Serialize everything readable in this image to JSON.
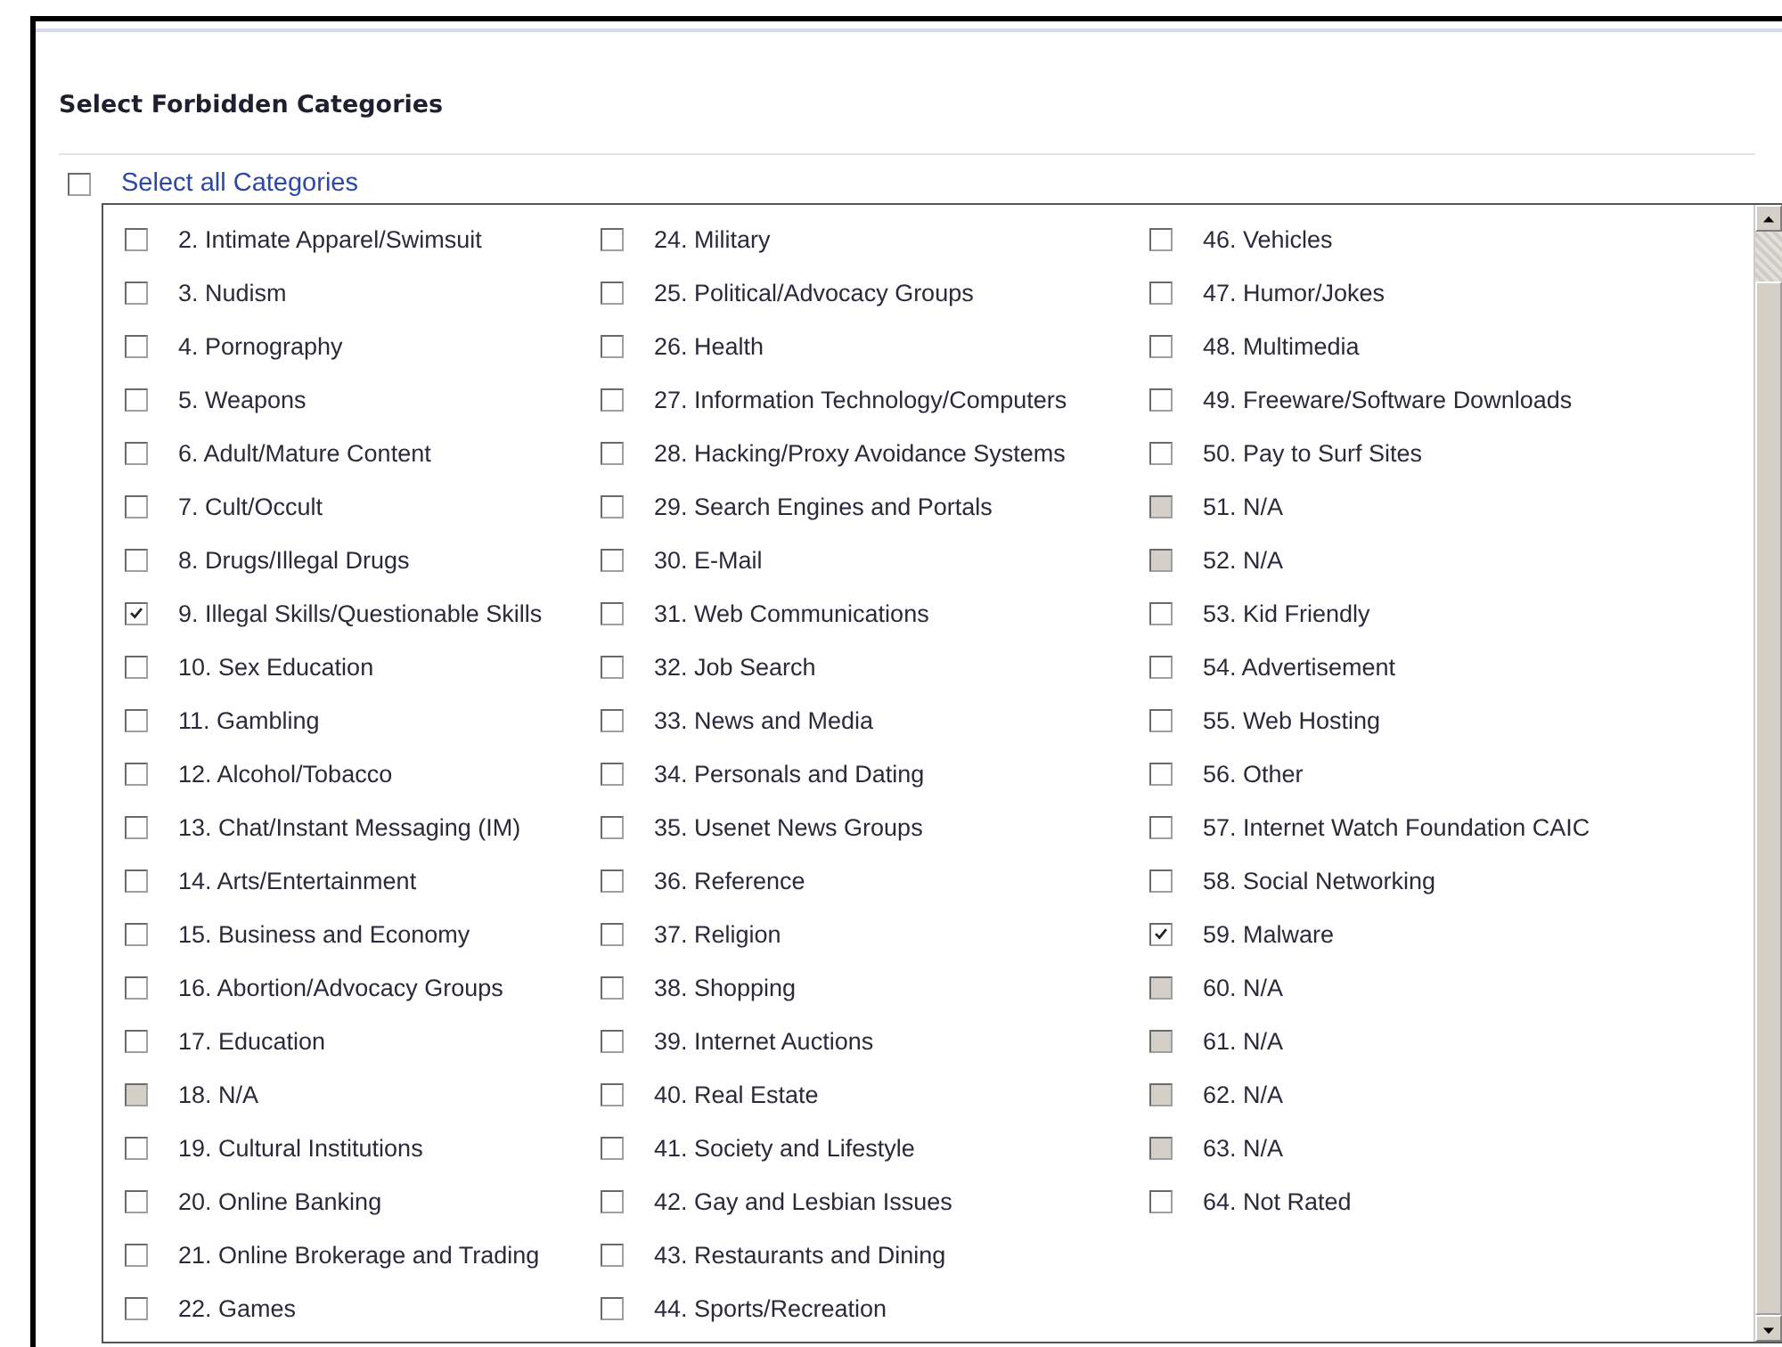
{
  "title": "Select Forbidden Categories",
  "select_all": {
    "label": "Select all Categories",
    "checked": false
  },
  "columns": [
    [
      {
        "label": "2. Intimate Apparel/Swimsuit",
        "checked": false,
        "disabled": false
      },
      {
        "label": "3. Nudism",
        "checked": false,
        "disabled": false
      },
      {
        "label": "4. Pornography",
        "checked": false,
        "disabled": false
      },
      {
        "label": "5. Weapons",
        "checked": false,
        "disabled": false
      },
      {
        "label": "6. Adult/Mature Content",
        "checked": false,
        "disabled": false
      },
      {
        "label": "7. Cult/Occult",
        "checked": false,
        "disabled": false
      },
      {
        "label": "8. Drugs/Illegal Drugs",
        "checked": false,
        "disabled": false
      },
      {
        "label": "9. Illegal Skills/Questionable Skills",
        "checked": true,
        "disabled": false
      },
      {
        "label": "10. Sex Education",
        "checked": false,
        "disabled": false
      },
      {
        "label": "11. Gambling",
        "checked": false,
        "disabled": false
      },
      {
        "label": "12. Alcohol/Tobacco",
        "checked": false,
        "disabled": false
      },
      {
        "label": "13. Chat/Instant Messaging (IM)",
        "checked": false,
        "disabled": false
      },
      {
        "label": "14. Arts/Entertainment",
        "checked": false,
        "disabled": false
      },
      {
        "label": "15. Business and Economy",
        "checked": false,
        "disabled": false
      },
      {
        "label": "16. Abortion/Advocacy Groups",
        "checked": false,
        "disabled": false
      },
      {
        "label": "17. Education",
        "checked": false,
        "disabled": false
      },
      {
        "label": "18. N/A",
        "checked": false,
        "disabled": true
      },
      {
        "label": "19. Cultural Institutions",
        "checked": false,
        "disabled": false
      },
      {
        "label": "20. Online Banking",
        "checked": false,
        "disabled": false
      },
      {
        "label": "21. Online Brokerage and Trading",
        "checked": false,
        "disabled": false
      },
      {
        "label": "22. Games",
        "checked": false,
        "disabled": false
      }
    ],
    [
      {
        "label": "24. Military",
        "checked": false,
        "disabled": false
      },
      {
        "label": "25. Political/Advocacy Groups",
        "checked": false,
        "disabled": false
      },
      {
        "label": "26. Health",
        "checked": false,
        "disabled": false
      },
      {
        "label": "27. Information Technology/Computers",
        "checked": false,
        "disabled": false
      },
      {
        "label": "28. Hacking/Proxy Avoidance Systems",
        "checked": false,
        "disabled": false
      },
      {
        "label": "29. Search Engines and Portals",
        "checked": false,
        "disabled": false
      },
      {
        "label": "30. E-Mail",
        "checked": false,
        "disabled": false
      },
      {
        "label": "31. Web Communications",
        "checked": false,
        "disabled": false
      },
      {
        "label": "32. Job Search",
        "checked": false,
        "disabled": false
      },
      {
        "label": "33. News and Media",
        "checked": false,
        "disabled": false
      },
      {
        "label": "34. Personals and Dating",
        "checked": false,
        "disabled": false
      },
      {
        "label": "35. Usenet News Groups",
        "checked": false,
        "disabled": false
      },
      {
        "label": "36. Reference",
        "checked": false,
        "disabled": false
      },
      {
        "label": "37. Religion",
        "checked": false,
        "disabled": false
      },
      {
        "label": "38. Shopping",
        "checked": false,
        "disabled": false
      },
      {
        "label": "39. Internet Auctions",
        "checked": false,
        "disabled": false
      },
      {
        "label": "40. Real Estate",
        "checked": false,
        "disabled": false
      },
      {
        "label": "41. Society and Lifestyle",
        "checked": false,
        "disabled": false
      },
      {
        "label": "42. Gay and Lesbian Issues",
        "checked": false,
        "disabled": false
      },
      {
        "label": "43. Restaurants and Dining",
        "checked": false,
        "disabled": false
      },
      {
        "label": "44. Sports/Recreation",
        "checked": false,
        "disabled": false
      }
    ],
    [
      {
        "label": "46. Vehicles",
        "checked": false,
        "disabled": false
      },
      {
        "label": "47. Humor/Jokes",
        "checked": false,
        "disabled": false
      },
      {
        "label": "48. Multimedia",
        "checked": false,
        "disabled": false
      },
      {
        "label": "49. Freeware/Software Downloads",
        "checked": false,
        "disabled": false
      },
      {
        "label": "50. Pay to Surf Sites",
        "checked": false,
        "disabled": false
      },
      {
        "label": "51. N/A",
        "checked": false,
        "disabled": true
      },
      {
        "label": "52. N/A",
        "checked": false,
        "disabled": true
      },
      {
        "label": "53. Kid Friendly",
        "checked": false,
        "disabled": false
      },
      {
        "label": "54. Advertisement",
        "checked": false,
        "disabled": false
      },
      {
        "label": "55. Web Hosting",
        "checked": false,
        "disabled": false
      },
      {
        "label": "56. Other",
        "checked": false,
        "disabled": false
      },
      {
        "label": "57. Internet Watch Foundation CAIC",
        "checked": false,
        "disabled": false
      },
      {
        "label": "58. Social Networking",
        "checked": false,
        "disabled": false
      },
      {
        "label": "59. Malware",
        "checked": true,
        "disabled": false
      },
      {
        "label": "60. N/A",
        "checked": false,
        "disabled": true
      },
      {
        "label": "61. N/A",
        "checked": false,
        "disabled": true
      },
      {
        "label": "62. N/A",
        "checked": false,
        "disabled": true
      },
      {
        "label": "63. N/A",
        "checked": false,
        "disabled": true
      },
      {
        "label": "64. Not Rated",
        "checked": false,
        "disabled": false
      }
    ]
  ]
}
